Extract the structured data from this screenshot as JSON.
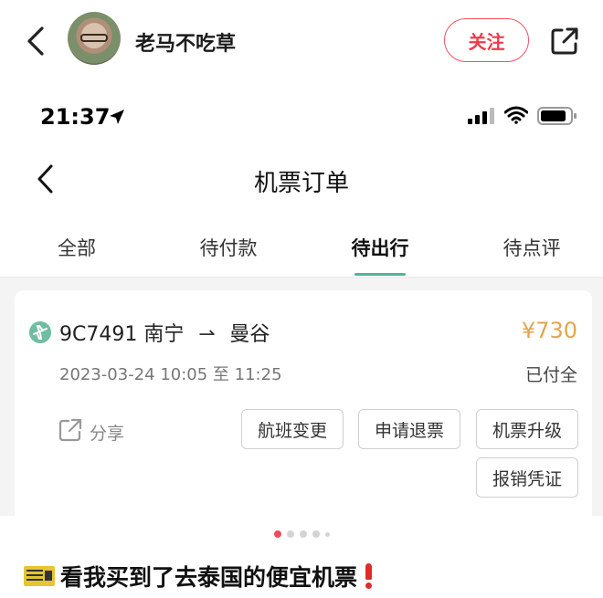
{
  "post": {
    "username": "老马不吃草",
    "follow_label": "关注",
    "caption": "看我买到了去泰国的便宜机票"
  },
  "screenshot": {
    "status_time": "21:37",
    "nav_title": "机票订单",
    "tabs": [
      {
        "label": "全部"
      },
      {
        "label": "待付款"
      },
      {
        "label": "待出行",
        "active": true
      },
      {
        "label": "待点评"
      }
    ],
    "order": {
      "flight_no": "9C7491",
      "from": "南宁",
      "to": "曼谷",
      "price": "¥730",
      "datetime": "2023-03-24 10:05 至 11:25",
      "status": "已付全",
      "share_label": "分享",
      "buttons": {
        "change": "航班变更",
        "refund": "申请退票",
        "upgrade": "机票升级",
        "reimburse": "报销凭证"
      }
    }
  },
  "carousel": {
    "total": 5,
    "current": 1
  },
  "icons": [
    "back-icon",
    "share-icon",
    "location-arrow-icon",
    "signal-icon",
    "wifi-icon",
    "battery-icon",
    "plane-icon",
    "ticket-emoji-icon",
    "exclamation-icon"
  ],
  "colors": {
    "accent_red": "#ef3c4b",
    "tab_green": "#4db69a",
    "price_gold": "#e2a64c"
  }
}
